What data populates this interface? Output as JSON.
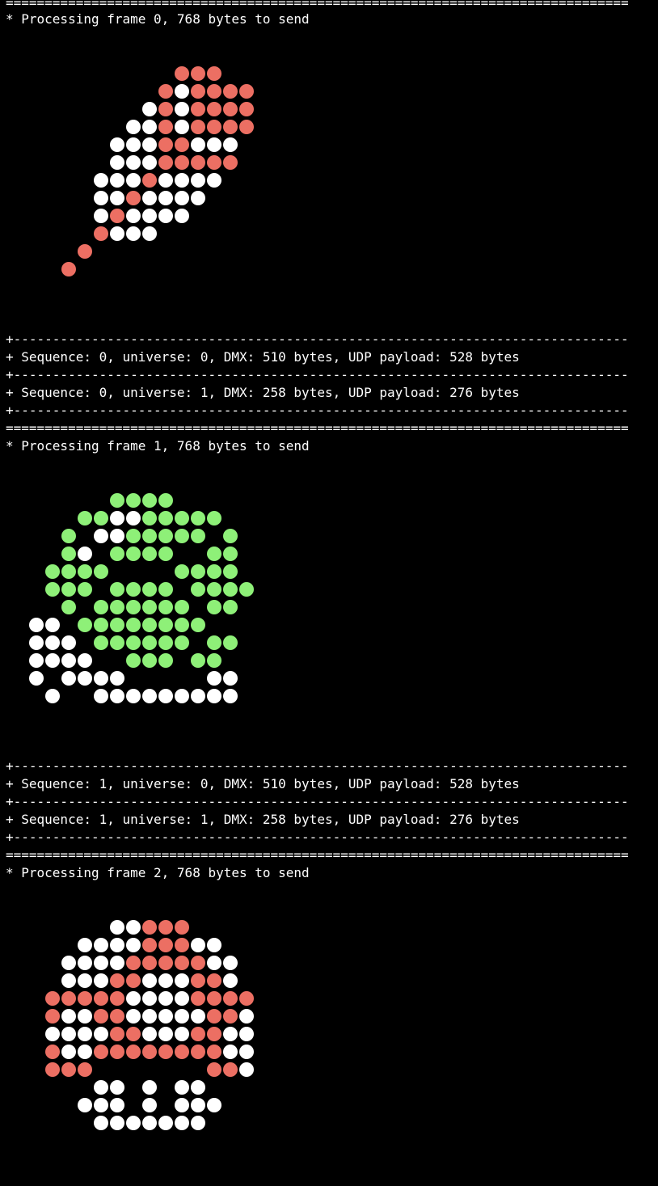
{
  "terminal": {
    "background": "#000000",
    "text_color": "#ffffff",
    "separators": {
      "double": "================================================================================",
      "single": "+-------------------------------------------------------------------------------"
    },
    "dot_colors": {
      "W": "#ffffff",
      "R": "#ec6f63",
      "G": "#8ef078"
    },
    "frames": [
      {
        "header": "* Processing frame 0, 768 bytes to send",
        "pattern": [
          "..........RRR...",
          ".........RWRRRR.",
          "........WRWRRRR.",
          ".......WWRWRRRR.",
          "......WWWRRWWW..",
          "......WWWRRRRR..",
          ".....WWWRWWWW...",
          ".....WWRWWWW....",
          ".....WRWWWW.....",
          ".....RWWW.......",
          "....R...........",
          "...R............"
        ],
        "log": [
          "+ Sequence: 0, universe: 0, DMX: 510 bytes, UDP payload: 528 bytes",
          "+ Sequence: 0, universe: 1, DMX: 258 bytes, UDP payload: 276 bytes"
        ]
      },
      {
        "header": "* Processing frame 1, 768 bytes to send",
        "pattern": [
          "......GGGG......",
          "....GGWWGGGGG...",
          "...G.WWGGGGG.G..",
          "...GW.GGGG..GG..",
          "..GGGG....GGGG..",
          "..GGG.GGGG.GGGG.",
          "...G.GGGGGG.GG..",
          ".WW.GGGGGGGG....",
          ".WWW.GGGGGG.GG..",
          ".WWWW..GGG.GG...",
          ".W.WWWW.....WW..",
          "..W..WWWWWWWWW.."
        ],
        "log": [
          "+ Sequence: 1, universe: 0, DMX: 510 bytes, UDP payload: 528 bytes",
          "+ Sequence: 1, universe: 1, DMX: 258 bytes, UDP payload: 276 bytes"
        ]
      },
      {
        "header": "* Processing frame 2, 768 bytes to send",
        "pattern": [
          "......WWRRR.....",
          "....WWWWRRRWW...",
          "...WWWWRRRRRWW..",
          "...WWWRRWWWRRW..",
          "..RRRRRWWWWRRRR.",
          "..RWWRRWWWWWRRW.",
          "..WWWWRRWWWRRWW.",
          "..RWWRRRRRRRRWW.",
          "..RRR.......RRW.",
          ".....WW.W.WW....",
          "....WWW.W.WWW...",
          ".....WWWWWWW...."
        ],
        "log": []
      }
    ]
  }
}
